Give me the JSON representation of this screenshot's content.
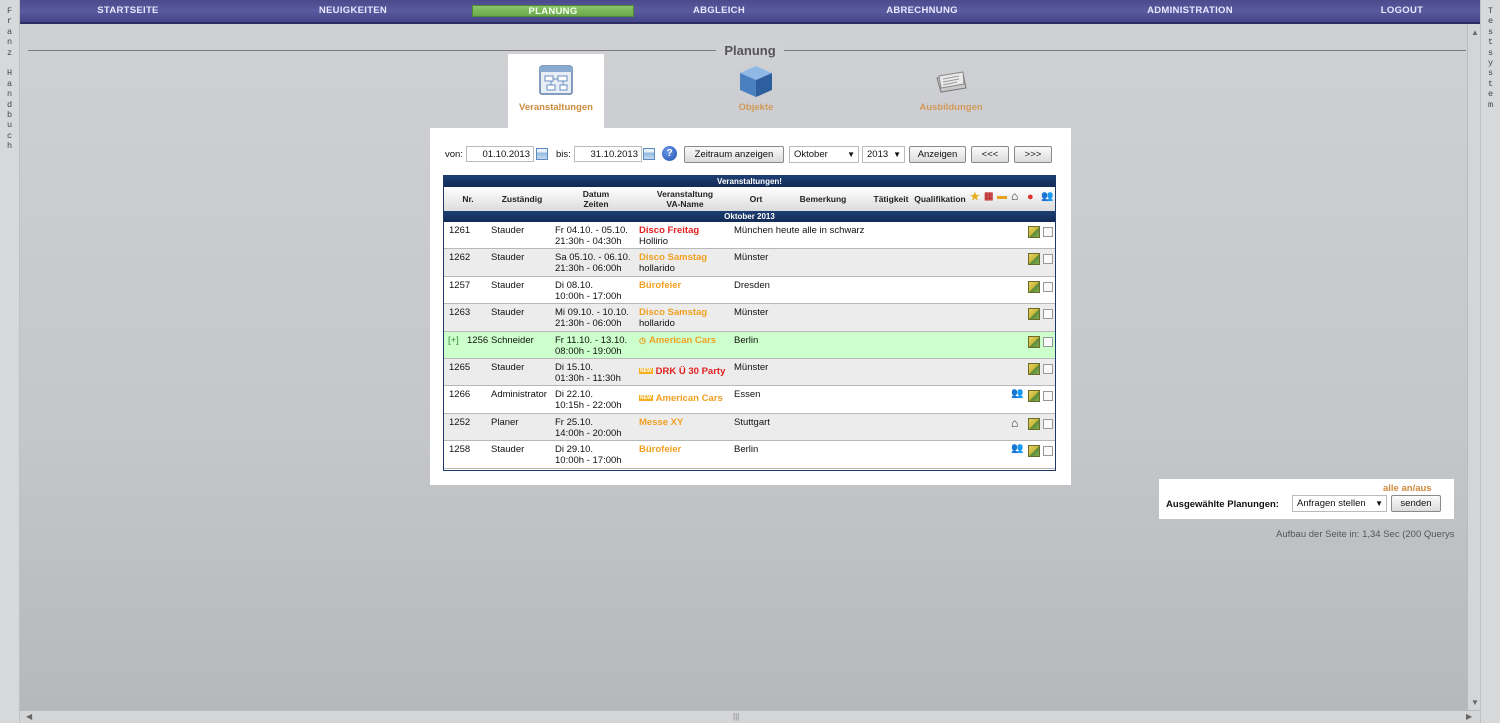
{
  "nav": {
    "items": [
      "STARTSEITE",
      "NEUIGKEITEN",
      "PLANUNG",
      "ABGLEICH",
      "ABRECHNUNG",
      "ADMINISTRATION",
      "LOGOUT"
    ],
    "active": "PLANUNG"
  },
  "side_left": [
    "F",
    "r",
    "a",
    "n",
    "z",
    "",
    "H",
    "a",
    "n",
    "d",
    "b",
    "u",
    "c",
    "h"
  ],
  "side_right": [
    "T",
    "e",
    "s",
    "t",
    "s",
    "y",
    "s",
    "t",
    "e",
    "m"
  ],
  "page_title": "Planung",
  "modules": [
    {
      "label": "Veranstaltungen",
      "icon": "event-board-icon",
      "active": true
    },
    {
      "label": "Objekte",
      "icon": "cube-icon",
      "active": false
    },
    {
      "label": "Ausbildungen",
      "icon": "book-icon",
      "active": false
    }
  ],
  "filter": {
    "von_label": "von:",
    "von_value": "01.10.2013",
    "bis_label": "bis:",
    "bis_value": "31.10.2013",
    "zeitraum_btn": "Zeitraum anzeigen",
    "month": "Oktober",
    "year": "2013",
    "anzeigen_btn": "Anzeigen",
    "prev_btn": "<<<",
    "next_btn": ">>>"
  },
  "table": {
    "title": "Veranstaltungen!",
    "headers": {
      "nr": "Nr.",
      "zustaendig": "Zuständig",
      "datum": "Datum",
      "zeiten": "Zeiten",
      "veranstaltung": "Veranstaltung",
      "va_name": "VA-Name",
      "ort": "Ort",
      "bemerkung": "Bemerkung",
      "taetigkeit": "Tätigkeit",
      "qualifikation": "Qualifikation"
    },
    "month_group": "Oktober 2013",
    "rows": [
      {
        "nr": "1261",
        "prefix": "",
        "zustaendig": "Stauder",
        "datum": "Fr 04.10. - 05.10.",
        "zeiten": "21:30h - 04:30h",
        "name": "Disco Freitag",
        "va_name": "Hollirio",
        "ort": "München heute alle in schwarz",
        "color": "red",
        "new": false,
        "extra": ""
      },
      {
        "nr": "1262",
        "prefix": "",
        "zustaendig": "Stauder",
        "datum": "Sa 05.10. - 06.10.",
        "zeiten": "21:30h - 06:00h",
        "name": "Disco Samstag",
        "va_name": "hollarido",
        "ort": "Münster",
        "color": "orange",
        "new": false,
        "extra": ""
      },
      {
        "nr": "1257",
        "prefix": "",
        "zustaendig": "Stauder",
        "datum": "Di 08.10.",
        "zeiten": "10:00h - 17:00h",
        "name": "Bürofeier",
        "va_name": "",
        "ort": "Dresden",
        "color": "orange",
        "new": false,
        "extra": ""
      },
      {
        "nr": "1263",
        "prefix": "",
        "zustaendig": "Stauder",
        "datum": "Mi 09.10. - 10.10.",
        "zeiten": "21:30h - 06:00h",
        "name": "Disco Samstag",
        "va_name": "hollarido",
        "ort": "Münster",
        "color": "orange",
        "new": false,
        "extra": ""
      },
      {
        "nr": "1256",
        "prefix": "[+]",
        "zustaendig": "Schneider",
        "datum": "Fr 11.10. - 13.10.",
        "zeiten": "08:00h - 19:00h",
        "name": "American Cars",
        "va_name": "",
        "ort": "Berlin",
        "color": "orange",
        "new": false,
        "extra": ""
      },
      {
        "nr": "1265",
        "prefix": "",
        "zustaendig": "Stauder",
        "datum": "Di 15.10.",
        "zeiten": "01:30h - 11:30h",
        "name": "DRK Ü 30 Party",
        "va_name": "",
        "ort": "Münster",
        "color": "red",
        "new": true,
        "extra": ""
      },
      {
        "nr": "1266",
        "prefix": "",
        "zustaendig": "Administrator",
        "datum": "Di 22.10.",
        "zeiten": "10:15h - 22:00h",
        "name": "American Cars",
        "va_name": "",
        "ort": "Essen",
        "color": "orange",
        "new": true,
        "extra": "people"
      },
      {
        "nr": "1252",
        "prefix": "",
        "zustaendig": "Planer",
        "datum": "Fr 25.10.",
        "zeiten": "14:00h - 20:00h",
        "name": "Messe XY",
        "va_name": "",
        "ort": "Stuttgart",
        "color": "orange",
        "new": false,
        "extra": "house"
      },
      {
        "nr": "1258",
        "prefix": "",
        "zustaendig": "Stauder",
        "datum": "Di 29.10.",
        "zeiten": "10:00h - 17:00h",
        "name": "Bürofeier",
        "va_name": "",
        "ort": "Berlin",
        "color": "orange",
        "new": false,
        "extra": "people"
      }
    ]
  },
  "bulk": {
    "toggle_all": "alle an/aus",
    "label": "Ausgewählte Planungen:",
    "action": "Anfragen stellen",
    "send_btn": "senden"
  },
  "footer_note": "Aufbau der Seite in: 1,34 Sec (200 Querys"
}
